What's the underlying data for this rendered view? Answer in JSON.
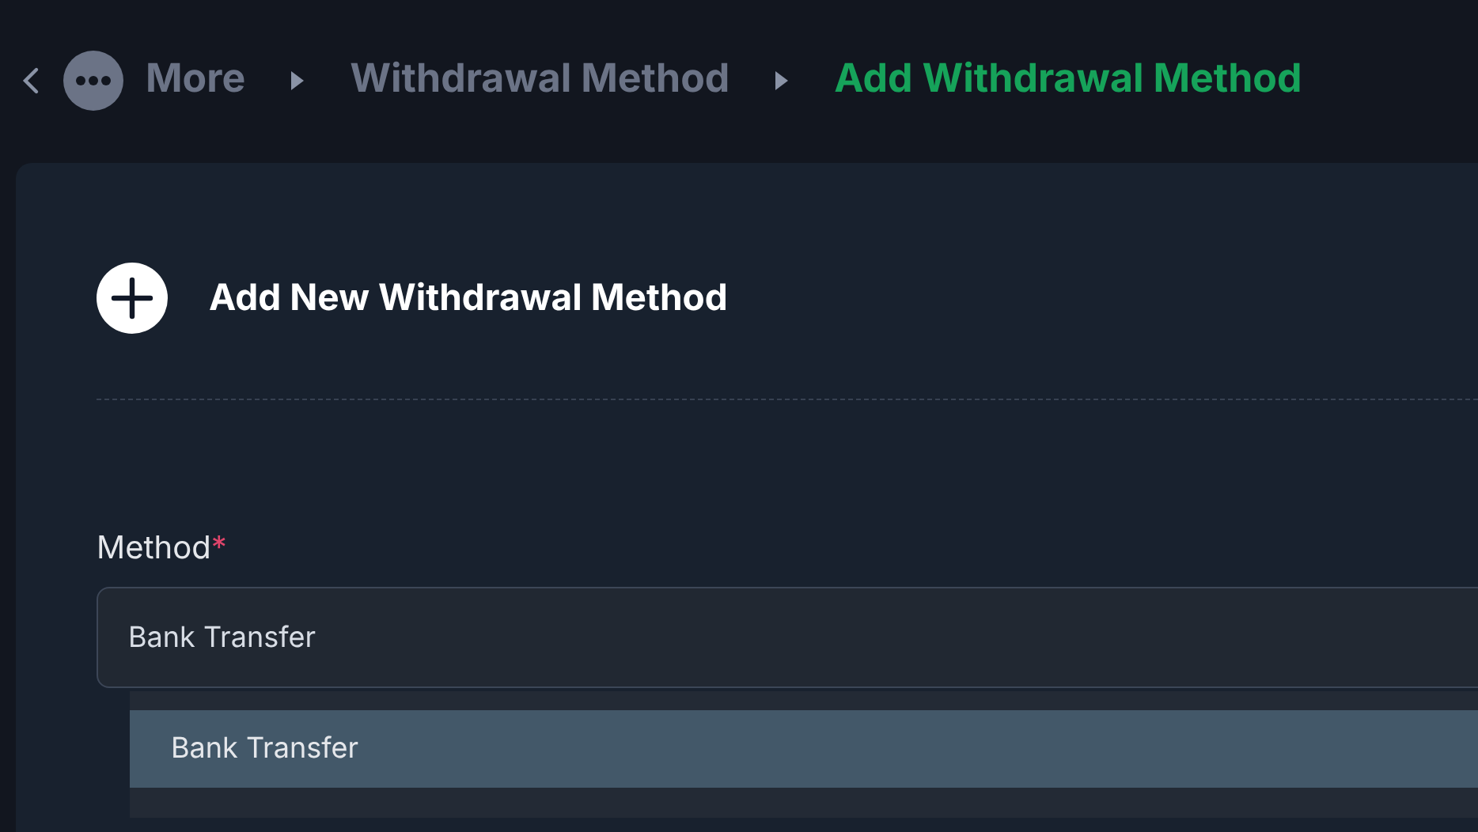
{
  "breadcrumb": [
    {
      "label": "More",
      "current": false
    },
    {
      "label": "Withdrawal Method",
      "current": false
    },
    {
      "label": "Add Withdrawal Method",
      "current": true
    }
  ],
  "card": {
    "title": "Add New Withdrawal Method"
  },
  "method_field": {
    "label": "Method",
    "required_mark": "*",
    "value": "Bank Transfer"
  },
  "dropdown": {
    "options": [
      {
        "label": "Bank Transfer",
        "selected": true
      }
    ]
  }
}
